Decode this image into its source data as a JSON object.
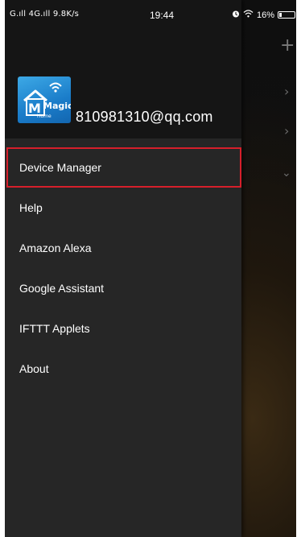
{
  "status_bar": {
    "signal_text": "G.ıll 4G.ıll 9.8K/s",
    "time": "19:44",
    "wifi_battery_text": "16%",
    "battery_level": 0.16
  },
  "drawer": {
    "logo_text": "Magic",
    "logo_subtext": "Home",
    "account_email": "810981310@qq.com",
    "menu": [
      {
        "label": "Device Manager"
      },
      {
        "label": "Help"
      },
      {
        "label": "Amazon Alexa"
      },
      {
        "label": "Google Assistant"
      },
      {
        "label": "IFTTT Applets"
      },
      {
        "label": "About"
      }
    ]
  },
  "background_app": {
    "icons": [
      "plus-icon",
      "chevron-right-icon",
      "chevron-right-icon",
      "chevron-down-icon"
    ]
  },
  "colors": {
    "drawer_bg": "#262626",
    "header_bg": "#151515",
    "highlight_border": "#d61f2b",
    "logo_blue": "#1a7cc9"
  }
}
